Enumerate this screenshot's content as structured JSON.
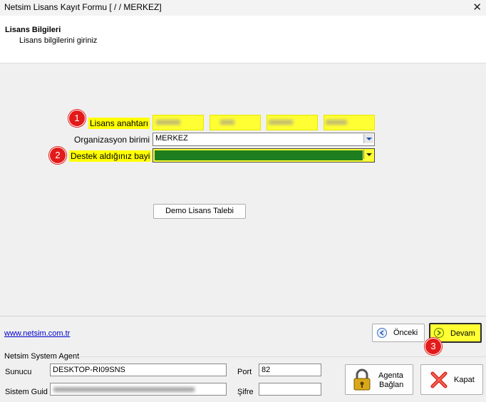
{
  "window": {
    "title": "Netsim Lisans Kayıt Formu [  /  / MERKEZ]"
  },
  "header": {
    "title": "Lisans Bilgileri",
    "subtitle": "Lisans bilgilerini giriniz"
  },
  "form": {
    "license_key_label": "Lisans anahtarı",
    "org_unit_label": "Organizasyon birimi",
    "org_unit_value": "MERKEZ",
    "dealer_label": "Destek aldığınız bayi",
    "demo_button": "Demo Lisans Talebi"
  },
  "badges": {
    "b1": "1",
    "b2": "2",
    "b3": "3"
  },
  "footer": {
    "link": "www.netsim.com.tr",
    "prev_label": "Önceki",
    "next_label": "Devam",
    "agent_group": "Netsim System Agent",
    "server_label": "Sunucu",
    "server_value": "DESKTOP-RI09SNS",
    "port_label": "Port",
    "port_value": "82",
    "guid_label": "Sistem Guid",
    "password_label": "Şifre",
    "agent_button_line1": "Agenta",
    "agent_button_line2": "Bağlan",
    "close_button": "Kapat"
  },
  "icons": {
    "close": "close-icon",
    "prev": "arrow-left-icon",
    "next": "arrow-right-icon",
    "lock": "padlock-icon",
    "kapat": "red-x-icon"
  },
  "colors": {
    "highlight": "#ffff00",
    "badge": "#e21a1a",
    "dealer_fill": "#1e7d1e",
    "link": "#0000cc"
  }
}
